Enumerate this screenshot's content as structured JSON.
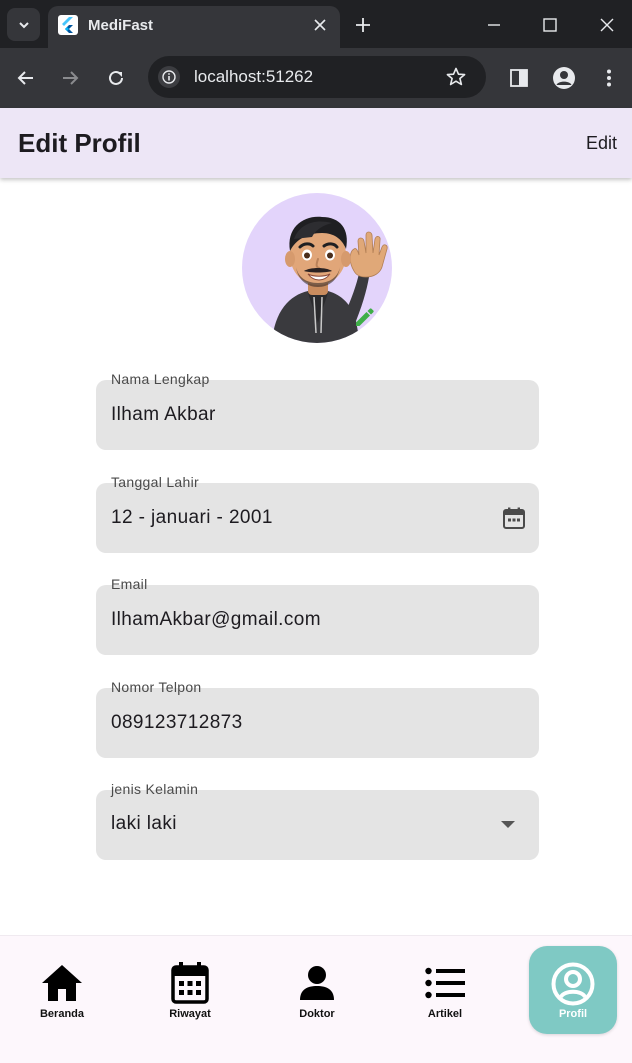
{
  "browser": {
    "tab_title": "MediFast",
    "url": "localhost:51262"
  },
  "appbar": {
    "title": "Edit Profil",
    "action_label": "Edit"
  },
  "form": {
    "fields": [
      {
        "label": "Nama Lengkap",
        "value": "Ilham Akbar"
      },
      {
        "label": "Tanggal Lahir",
        "value": "12 - januari - 2001",
        "icon": "calendar-icon"
      },
      {
        "label": "Email",
        "value": "IlhamAkbar@gmail.com"
      },
      {
        "label": "Nomor Telpon",
        "value": "089123712873"
      },
      {
        "label": "jenis Kelamin",
        "value": "laki laki",
        "icon": "dropdown-arrow-icon"
      }
    ]
  },
  "bottom_nav": {
    "items": [
      {
        "label": "Beranda",
        "icon": "home-icon"
      },
      {
        "label": "Riwayat",
        "icon": "calendar-icon"
      },
      {
        "label": "Doktor",
        "icon": "person-icon"
      },
      {
        "label": "Artikel",
        "icon": "list-icon"
      },
      {
        "label": "Profil",
        "icon": "account-circle-icon",
        "active": true
      }
    ]
  },
  "colors": {
    "appbar_bg": "#ede6f6",
    "field_bg": "#e4e4e4",
    "active_nav_bg": "#7fc9c4",
    "avatar_bg": "#e3d4fb",
    "edit_pen": "#3fae49"
  }
}
